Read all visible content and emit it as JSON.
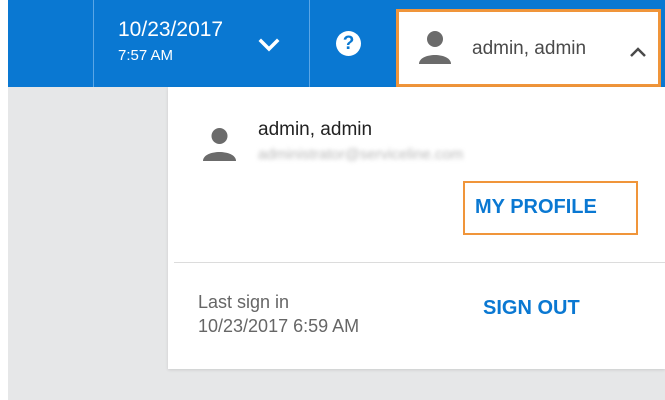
{
  "header": {
    "date": "10/23/2017",
    "time": "7:57 AM",
    "help_symbol": "?",
    "user_label": "admin, admin",
    "icons": {
      "datetime_toggle": "chevron-down-icon",
      "help": "help-icon",
      "user": "person-icon",
      "user_toggle": "chevron-up-icon"
    }
  },
  "account_menu": {
    "name": "admin, admin",
    "email": "administrator@serviceline.com",
    "my_profile_label": "MY PROFILE",
    "last_sign_in_label": "Last sign in",
    "last_sign_in_time": "10/23/2017 6:59 AM",
    "sign_out_label": "SIGN OUT"
  },
  "colors": {
    "header_blue": "#0a78d2",
    "highlight_orange": "#f0953a",
    "page_gray": "#e6e7e8",
    "link_blue": "#0a78d2"
  }
}
